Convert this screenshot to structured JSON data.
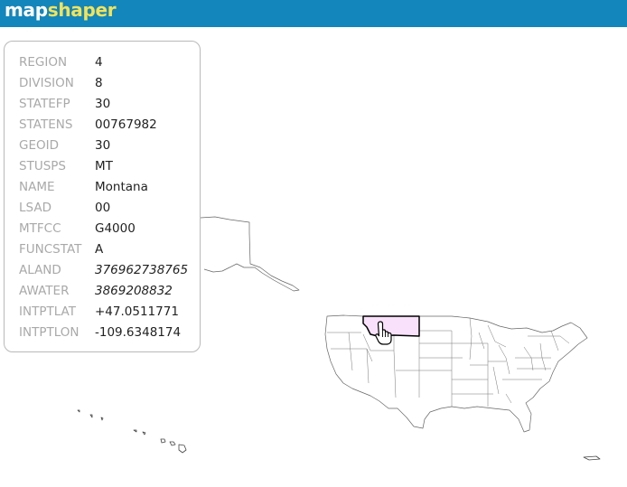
{
  "app": {
    "title_part1": "map",
    "title_part2": "shaper",
    "title_colors": {
      "part1": "#ffffff",
      "part2": "#f2e35b"
    },
    "topbar_color": "#1386bb"
  },
  "popup": {
    "rows": [
      {
        "key": "REGION",
        "value": "4"
      },
      {
        "key": "DIVISION",
        "value": "8"
      },
      {
        "key": "STATEFP",
        "value": "30"
      },
      {
        "key": "STATENS",
        "value": "00767982"
      },
      {
        "key": "GEOID",
        "value": "30"
      },
      {
        "key": "STUSPS",
        "value": "MT"
      },
      {
        "key": "NAME",
        "value": "Montana"
      },
      {
        "key": "LSAD",
        "value": "00"
      },
      {
        "key": "MTFCC",
        "value": "G4000"
      },
      {
        "key": "FUNCSTAT",
        "value": "A"
      },
      {
        "key": "ALAND",
        "value": "376962738765"
      },
      {
        "key": "AWATER",
        "value": "3869208832"
      },
      {
        "key": "INTPTLAT",
        "value": "+47.0511771"
      },
      {
        "key": "INTPTLON",
        "value": "-109.6348174"
      }
    ]
  },
  "map": {
    "highlight_color": "#f9e1fb",
    "cursor": "hand-pointer-icon"
  }
}
